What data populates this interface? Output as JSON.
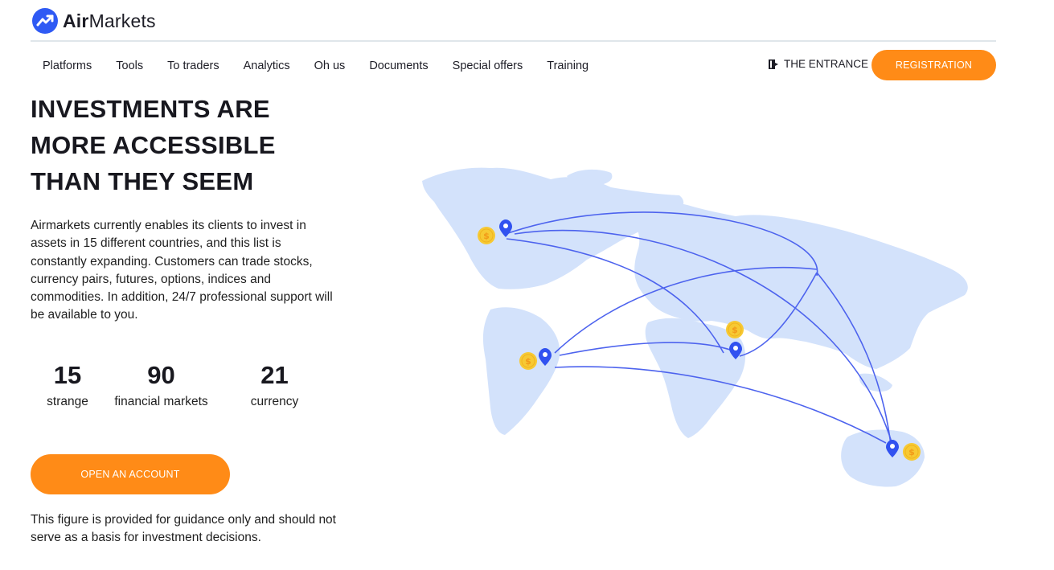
{
  "brand": {
    "name_bold": "Air",
    "name_rest": "Markets",
    "accent": "#2f5af4"
  },
  "nav": {
    "items": [
      "Platforms",
      "Tools",
      "To traders",
      "Analytics",
      "Oh us",
      "Documents",
      "Special offers",
      "Training"
    ]
  },
  "header": {
    "entrance_label": "THE ENTRANCE",
    "registration_label": "REGISTRATION"
  },
  "hero": {
    "title_lines": [
      "INVESTMENTS ARE",
      "MORE ACCESSIBLE",
      "THAN THEY SEEM"
    ],
    "description": "Airmarkets currently enables its clients to invest in assets in 15 different countries, and this list is constantly expanding. Customers can trade stocks, currency pairs, futures, options, indices and commodities. In addition, 24/7 professional support will be available to you."
  },
  "stats": [
    {
      "value": "15",
      "label": "strange"
    },
    {
      "value": "90",
      "label": "financial markets"
    },
    {
      "value": "21",
      "label": "currency"
    }
  ],
  "cta": {
    "open_account_label": "OPEN AN ACCOUNT"
  },
  "disclaimer": "This figure is provided for guidance only and should not serve as a basis for investment decisions.",
  "colors": {
    "orange": "#ff8b17",
    "map_land": "#d3e2fb",
    "route": "#4d63ee",
    "pin": "#3152f0",
    "coin": "#f7c933",
    "coin_symbol": "#f29a18"
  }
}
